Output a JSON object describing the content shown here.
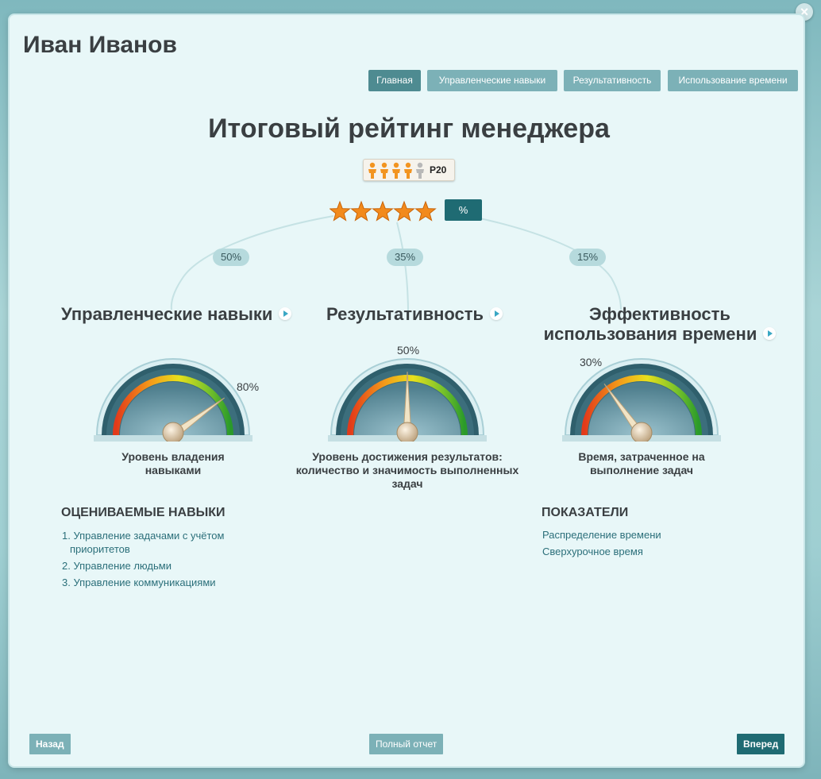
{
  "window": {
    "close_symbol": "×",
    "user_name": "Иван Иванов"
  },
  "tabs": [
    {
      "label": "Главная",
      "active": true
    },
    {
      "label": "Управленческие навыки",
      "active": false
    },
    {
      "label": "Результативность",
      "active": false
    },
    {
      "label": "Использование времени",
      "active": false
    }
  ],
  "summary": {
    "title": "Итоговый рейтинг менеджера",
    "rank": {
      "label": "Р20",
      "icons_filled": 4,
      "icons_total": 5
    },
    "stars": {
      "filled": 5,
      "total": 5
    },
    "percent_label": "%"
  },
  "sections": [
    {
      "weight": "50%",
      "title": "Управленческие навыки",
      "gauge_value": "80%",
      "gauge_fraction": 0.8,
      "caption": "Уровень владения навыками"
    },
    {
      "weight": "35%",
      "title": "Результативность",
      "gauge_value": "50%",
      "gauge_fraction": 0.5,
      "caption": "Уровень достижения результатов: количество и значимость выполненных задач"
    },
    {
      "weight": "15%",
      "title": "Эффективность использования времени",
      "gauge_value": "30%",
      "gauge_fraction": 0.3,
      "caption": "Время, затраченное на выполнение задач"
    }
  ],
  "skills": {
    "heading": "ОЦЕНИВАЕМЫЕ НАВЫКИ",
    "items": [
      {
        "num": "1.",
        "text": "Управление задачами с учётом приоритетов"
      },
      {
        "num": "2.",
        "text": "Управление людьми"
      },
      {
        "num": "3.",
        "text": "Управление коммуникациями"
      }
    ]
  },
  "indicators": {
    "heading": "ПОКАЗАТЕЛИ",
    "items": [
      "Распределение времени",
      "Сверхурочное время"
    ]
  },
  "footer": {
    "back_label": "Назад",
    "report_label": "Полный отчет",
    "next_label": "Вперед"
  },
  "colors": {
    "accent_dark": "#1f6b73",
    "tab_active": "#4e8b91",
    "tab_inactive": "#7cb1b7",
    "star": "#f28a1c",
    "person_filled": "#f29420",
    "person_empty": "#b8b8b8"
  }
}
